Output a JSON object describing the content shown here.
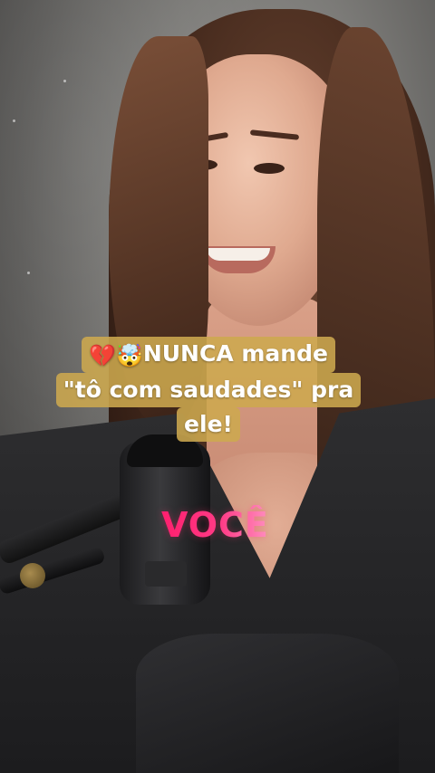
{
  "caption": {
    "line1": "NUNCA mande",
    "line2": "\"tô com saudades\" pra",
    "line3": "ele!",
    "emoji_1": "💔",
    "emoji_2": "🤯"
  },
  "overlay_word": "VOCÊ",
  "colors": {
    "caption_background": "#cda84e",
    "caption_text": "#ffffff",
    "overlay_word": "#ff2a6f"
  },
  "icons": [
    "broken-heart-icon",
    "mind-blown-icon"
  ]
}
